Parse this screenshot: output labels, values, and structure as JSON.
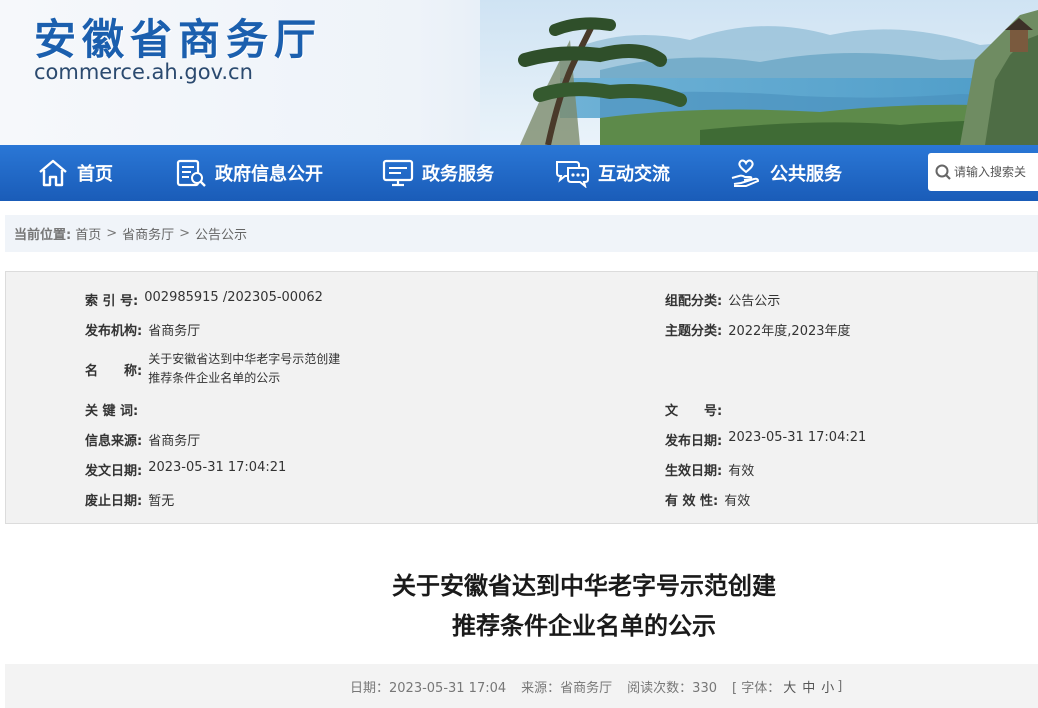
{
  "header": {
    "site_title": "安徽省商务厅",
    "site_domain": "commerce.ah.gov.cn"
  },
  "nav": {
    "items": [
      {
        "label": "首页",
        "icon": "home-icon"
      },
      {
        "label": "政府信息公开",
        "icon": "document-icon"
      },
      {
        "label": "政务服务",
        "icon": "monitor-icon"
      },
      {
        "label": "互动交流",
        "icon": "chat-icon"
      },
      {
        "label": "公共服务",
        "icon": "hand-heart-icon"
      }
    ],
    "search_placeholder": "请输入搜索关"
  },
  "breadcrumb": {
    "label": "当前位置:",
    "items": [
      "首页",
      "省商务厅",
      "公告公示"
    ],
    "separator": ">"
  },
  "meta": {
    "index_no_key": "索 引 号:",
    "index_no": "002985915 /202305-00062",
    "category_key": "组配分类:",
    "category": "公告公示",
    "publisher_key": "发布机构:",
    "publisher": "省商务厅",
    "topic_key": "主题分类:",
    "topic": "2022年度,2023年度",
    "name_key": "名　　称:",
    "name_line1": "关于安徽省达到中华老字号示范创建",
    "name_line2": "推荐条件企业名单的公示",
    "keywords_key": "关 键 词:",
    "keywords": "",
    "doc_no_key": "文　　号:",
    "doc_no": "",
    "source_key": "信息来源:",
    "source": "省商务厅",
    "publish_date_key": "发布日期:",
    "publish_date": "2023-05-31 17:04:21",
    "issue_date_key": "发文日期:",
    "issue_date": "2023-05-31 17:04:21",
    "effective_date_key": "生效日期:",
    "effective_date": "有效",
    "abolish_date_key": "废止日期:",
    "abolish_date": "暂无",
    "validity_key": "有 效 性:",
    "validity": "有效"
  },
  "article": {
    "title_line1": "关于安徽省达到中华老字号示范创建",
    "title_line2": "推荐条件企业名单的公示"
  },
  "info_bar": {
    "date": "日期：2023-05-31 17:04",
    "source": "来源：省商务厅",
    "views": "阅读次数：330",
    "font_open": "[ 字体：",
    "font_large": "大",
    "font_medium": "中",
    "font_small": "小",
    "font_close": "]"
  },
  "colors": {
    "brand_blue": "#1b5fae",
    "nav_top": "#2a77d6",
    "nav_bottom": "#1a5cb8"
  }
}
